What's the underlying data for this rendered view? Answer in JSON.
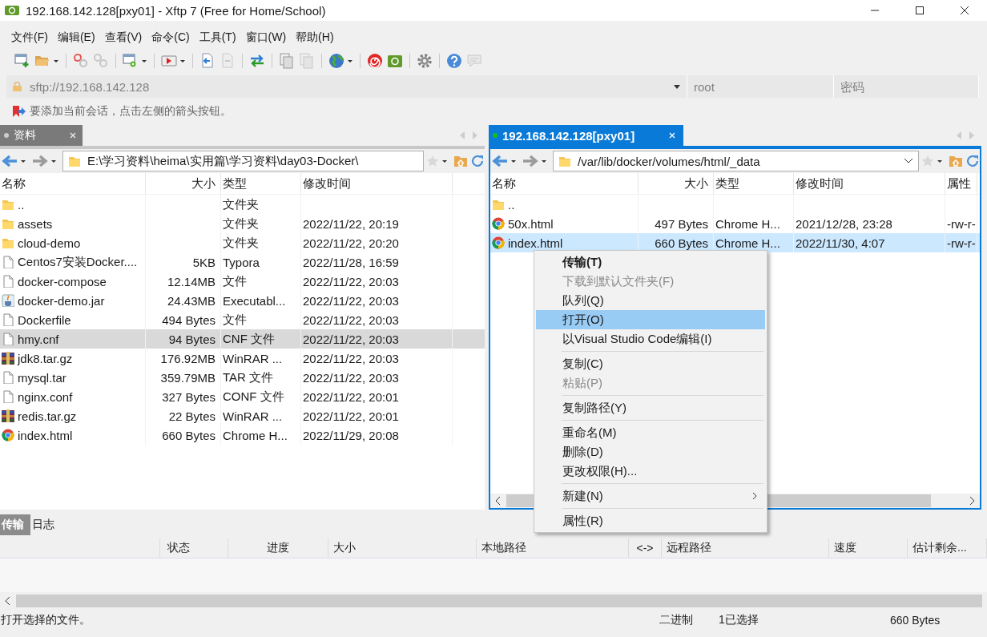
{
  "window": {
    "title": "192.168.142.128[pxy01] - Xftp 7 (Free for Home/School)"
  },
  "menu_bar": [
    "文件(F)",
    "编辑(E)",
    "查看(V)",
    "命令(C)",
    "工具(T)",
    "窗口(W)",
    "帮助(H)"
  ],
  "address_bar": {
    "url": "sftp://192.168.142.128",
    "user": "root",
    "password_placeholder": "密码"
  },
  "notice": "要添加当前会话，点击左侧的箭头按钮。",
  "panes": [
    {
      "tab": {
        "label": "资料",
        "selected": false
      },
      "path": "E:\\学习资料\\heima\\实用篇\\学习资料\\day03-Docker\\",
      "columns": [
        "名称",
        "大小",
        "类型",
        "修改时间"
      ],
      "rows": [
        {
          "kind": "folder",
          "name": "..",
          "type": "文件夹",
          "selected": false
        },
        {
          "kind": "folder",
          "name": "assets",
          "type": "文件夹",
          "modified": "2022/11/22, 20:19",
          "selected": false
        },
        {
          "kind": "folder",
          "name": "cloud-demo",
          "type": "文件夹",
          "modified": "2022/11/22, 20:20",
          "selected": false
        },
        {
          "kind": "file",
          "name": "Centos7安装Docker....",
          "size": "5KB",
          "type": "Typora",
          "modified": "2022/11/28, 16:59",
          "selected": false
        },
        {
          "kind": "file",
          "name": "docker-compose",
          "size": "12.14MB",
          "type": "文件",
          "modified": "2022/11/22, 20:03",
          "selected": false
        },
        {
          "kind": "jar",
          "name": "docker-demo.jar",
          "size": "24.43MB",
          "type": "Executabl...",
          "modified": "2022/11/22, 20:03",
          "selected": false
        },
        {
          "kind": "file",
          "name": "Dockerfile",
          "size": "494 Bytes",
          "type": "文件",
          "modified": "2022/11/22, 20:03",
          "selected": false
        },
        {
          "kind": "file",
          "name": "hmy.cnf",
          "size": "94 Bytes",
          "type": "CNF 文件",
          "modified": "2022/11/22, 20:03",
          "selected": true
        },
        {
          "kind": "archive",
          "name": "jdk8.tar.gz",
          "size": "176.92MB",
          "type": "WinRAR ...",
          "modified": "2022/11/22, 20:03",
          "selected": false
        },
        {
          "kind": "file",
          "name": "mysql.tar",
          "size": "359.79MB",
          "type": "TAR 文件",
          "modified": "2022/11/22, 20:03",
          "selected": false
        },
        {
          "kind": "file",
          "name": "nginx.conf",
          "size": "327 Bytes",
          "type": "CONF 文件",
          "modified": "2022/11/22, 20:01",
          "selected": false
        },
        {
          "kind": "archive",
          "name": "redis.tar.gz",
          "size": "22 Bytes",
          "type": "WinRAR ...",
          "modified": "2022/11/22, 20:01",
          "selected": false
        },
        {
          "kind": "chrome",
          "name": "index.html",
          "size": "660 Bytes",
          "type": "Chrome H...",
          "modified": "2022/11/29, 20:08",
          "selected": false
        }
      ]
    },
    {
      "tab": {
        "label": "192.168.142.128[pxy01]",
        "selected": true
      },
      "path": "/var/lib/docker/volumes/html/_data",
      "columns": [
        "名称",
        "大小",
        "类型",
        "修改时间",
        "属性"
      ],
      "rows": [
        {
          "kind": "folder",
          "name": "..",
          "selected": false
        },
        {
          "kind": "chrome",
          "name": "50x.html",
          "size": "497 Bytes",
          "type": "Chrome H...",
          "modified": "2021/12/28, 23:28",
          "attributes": "-rw-r-",
          "selected": false
        },
        {
          "kind": "chrome",
          "name": "index.html",
          "size": "660 Bytes",
          "type": "Chrome H...",
          "modified": "2022/11/30, 4:07",
          "attributes": "-rw-r-",
          "selected": true
        }
      ]
    }
  ],
  "context_menu": [
    {
      "kind": "item",
      "label": "传输(T)",
      "bold": true,
      "disabled": false,
      "highlighted": false,
      "submenu": false
    },
    {
      "kind": "item",
      "label": "下载到默认文件夹(F)",
      "bold": false,
      "disabled": true,
      "highlighted": false,
      "submenu": false
    },
    {
      "kind": "item",
      "label": "队列(Q)",
      "bold": false,
      "disabled": false,
      "highlighted": false,
      "submenu": false
    },
    {
      "kind": "item",
      "label": "打开(O)",
      "bold": false,
      "disabled": false,
      "highlighted": true,
      "submenu": false
    },
    {
      "kind": "item",
      "label": "以Visual Studio Code编辑(I)",
      "bold": false,
      "disabled": false,
      "highlighted": false,
      "submenu": false
    },
    {
      "kind": "separator"
    },
    {
      "kind": "item",
      "label": "复制(C)",
      "bold": false,
      "disabled": false,
      "highlighted": false,
      "submenu": false
    },
    {
      "kind": "item",
      "label": "粘贴(P)",
      "bold": false,
      "disabled": true,
      "highlighted": false,
      "submenu": false
    },
    {
      "kind": "separator"
    },
    {
      "kind": "item",
      "label": "复制路径(Y)",
      "bold": false,
      "disabled": false,
      "highlighted": false,
      "submenu": false
    },
    {
      "kind": "separator"
    },
    {
      "kind": "item",
      "label": "重命名(M)",
      "bold": false,
      "disabled": false,
      "highlighted": false,
      "submenu": false
    },
    {
      "kind": "item",
      "label": "删除(D)",
      "bold": false,
      "disabled": false,
      "highlighted": false,
      "submenu": false
    },
    {
      "kind": "item",
      "label": "更改权限(H)...",
      "bold": false,
      "disabled": false,
      "highlighted": false,
      "submenu": false
    },
    {
      "kind": "separator"
    },
    {
      "kind": "item",
      "label": "新建(N)",
      "bold": false,
      "disabled": false,
      "highlighted": false,
      "submenu": true
    },
    {
      "kind": "separator"
    },
    {
      "kind": "item",
      "label": "属性(R)",
      "bold": false,
      "disabled": false,
      "highlighted": false,
      "submenu": false
    }
  ],
  "bottom_tabs": [
    {
      "label": "传输",
      "selected": true
    },
    {
      "label": "日志",
      "selected": false
    }
  ],
  "transfer_columns": [
    "状态",
    "进度",
    "大小",
    "本地路径",
    "<->",
    "远程路径",
    "速度",
    "估计剩余..."
  ],
  "status_bar": {
    "message": "打开选择的文件。",
    "mode": "二进制",
    "selection": "1已选择",
    "size": "660 Bytes"
  }
}
